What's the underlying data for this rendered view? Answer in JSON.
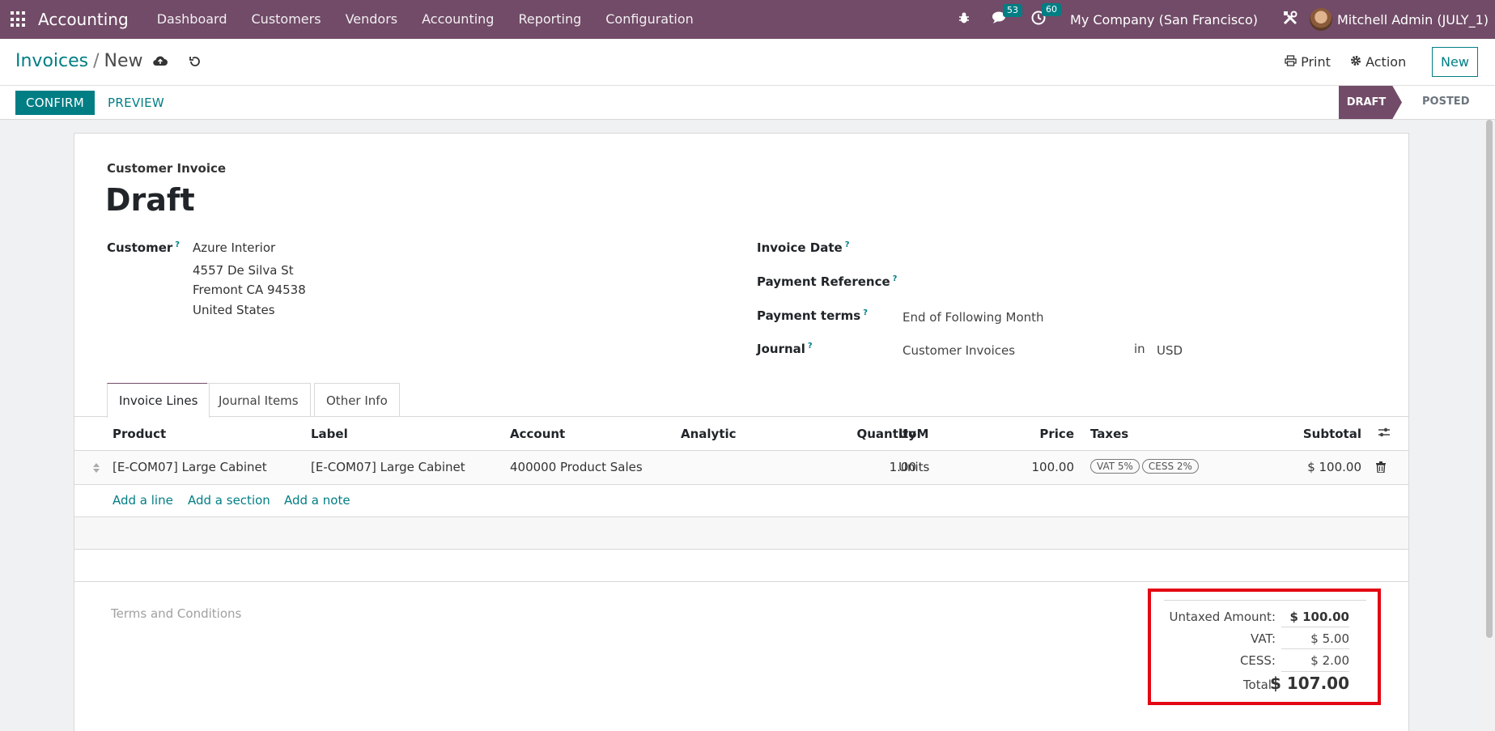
{
  "navbar": {
    "brand": "Accounting",
    "menu": [
      "Dashboard",
      "Customers",
      "Vendors",
      "Accounting",
      "Reporting",
      "Configuration"
    ],
    "messages_count": "53",
    "activities_count": "60",
    "company": "My Company (San Francisco)",
    "user": "Mitchell Admin (JULY_1)"
  },
  "control": {
    "breadcrumb_parent": "Invoices",
    "breadcrumb_separator": "/",
    "breadcrumb_current": "New",
    "print_label": "Print",
    "action_label": "Action",
    "new_label": "New"
  },
  "statusbar": {
    "confirm_label": "CONFIRM",
    "preview_label": "PREVIEW",
    "stages": [
      "DRAFT",
      "POSTED"
    ],
    "active_stage": "DRAFT"
  },
  "form": {
    "doc_type": "Customer Invoice",
    "title": "Draft",
    "customer_label": "Customer",
    "customer_name": "Azure Interior",
    "customer_address": [
      "4557 De Silva St",
      "Fremont CA 94538",
      "United States"
    ],
    "invoice_date_label": "Invoice Date",
    "payment_reference_label": "Payment Reference",
    "payment_terms_label": "Payment terms",
    "payment_terms_value": "End of Following Month",
    "journal_label": "Journal",
    "journal_value": "Customer Invoices",
    "journal_in": "in",
    "currency": "USD",
    "help_mark": "?"
  },
  "tabs": [
    "Invoice Lines",
    "Journal Items",
    "Other Info"
  ],
  "table": {
    "headers": {
      "product": "Product",
      "label": "Label",
      "account": "Account",
      "analytic": "Analytic",
      "quantity": "Quantity",
      "uom": "UoM",
      "price": "Price",
      "taxes": "Taxes",
      "subtotal": "Subtotal"
    },
    "rows": [
      {
        "product": "[E-COM07] Large Cabinet",
        "label": "[E-COM07] Large Cabinet",
        "account": "400000 Product Sales",
        "analytic": "",
        "quantity": "1.00",
        "uom": "Units",
        "price": "100.00",
        "taxes": [
          "VAT 5%",
          "CESS 2%"
        ],
        "subtotal": "$ 100.00"
      }
    ],
    "add_line": "Add a line",
    "add_section": "Add a section",
    "add_note": "Add a note"
  },
  "terms_placeholder": "Terms and Conditions",
  "totals": {
    "untaxed_label": "Untaxed Amount:",
    "untaxed_value": "$ 100.00",
    "vat_label": "VAT:",
    "vat_value": "$ 5.00",
    "cess_label": "CESS:",
    "cess_value": "$ 2.00",
    "total_label": "Total:",
    "total_value": "$ 107.00"
  },
  "colors": {
    "brand": "#714b67",
    "accent": "#017e84",
    "highlight": "#e30613"
  }
}
